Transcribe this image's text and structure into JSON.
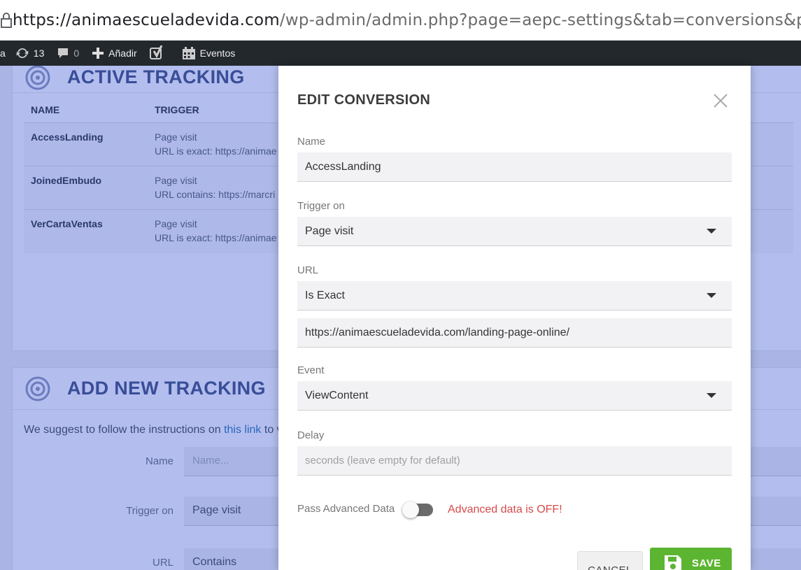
{
  "browser": {
    "url_host": "https://animaescueladevida.com",
    "url_path": "/wp-admin/admin.php?page=aepc-settings&tab=conversions&paged"
  },
  "adminbar": {
    "site_fragment": "a",
    "updates_count": "13",
    "comments_count": "0",
    "add_label": "Añadir",
    "events_label": "Eventos"
  },
  "active_tracking": {
    "title": "ACTIVE TRACKING",
    "columns": [
      "NAME",
      "TRIGGER"
    ],
    "rows": [
      {
        "name": "AccessLanding",
        "trigger": "Page visit",
        "rule": "URL is exact: https://animae"
      },
      {
        "name": "JoinedEmbudo",
        "trigger": "Page visit",
        "rule": "URL contains: https://marcri"
      },
      {
        "name": "VerCartaVentas",
        "trigger": "Page visit",
        "rule": "URL is exact: https://animae"
      }
    ]
  },
  "add_tracking": {
    "title": "ADD NEW TRACKING",
    "suggest_prefix": "We suggest to follow the instructions on ",
    "suggest_link": "this link",
    "suggest_suffix": " to v",
    "name_label": "Name",
    "name_placeholder": "Name...",
    "trigger_label": "Trigger on",
    "trigger_value": "Page visit",
    "url_label": "URL",
    "url_value": "Contains"
  },
  "modal": {
    "title": "EDIT CONVERSION",
    "name_label": "Name",
    "name_value": "AccessLanding",
    "trigger_label": "Trigger on",
    "trigger_value": "Page visit",
    "url_label": "URL",
    "url_match": "Is Exact",
    "url_value": "https://animaescueladevida.com/landing-page-online/",
    "event_label": "Event",
    "event_value": "ViewContent",
    "delay_label": "Delay",
    "delay_placeholder": "seconds (leave empty for default)",
    "pass_label": "Pass Advanced Data",
    "pass_status": "Advanced data is OFF!",
    "cancel_label": "CANCEL",
    "save_label": "SAVE"
  },
  "colors": {
    "save_green": "#5cb531",
    "warning_red": "#d94a4a",
    "overlay_blue": "#3755d2",
    "heading_navy": "#3a4a74"
  }
}
